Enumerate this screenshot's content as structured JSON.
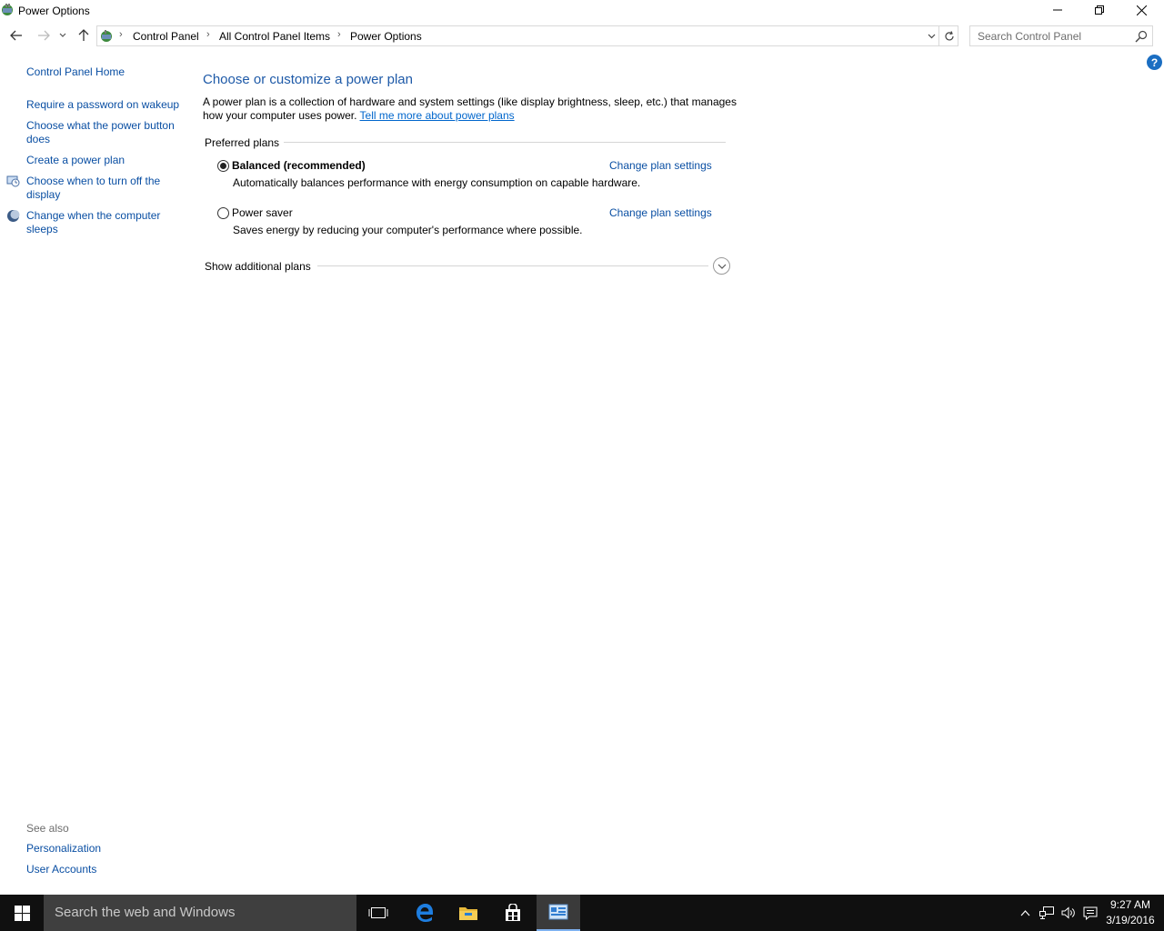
{
  "window": {
    "title": "Power Options"
  },
  "address_bar": {
    "breadcrumbs": [
      "Control Panel",
      "All Control Panel Items",
      "Power Options"
    ]
  },
  "search": {
    "placeholder": "Search Control Panel"
  },
  "help": {
    "label": "?"
  },
  "sidebar": {
    "home": "Control Panel Home",
    "items": [
      {
        "label": "Require a password on wakeup",
        "icon": "none"
      },
      {
        "label": "Choose what the power button does",
        "icon": "none"
      },
      {
        "label": "Create a power plan",
        "icon": "none"
      },
      {
        "label": "Choose when to turn off the display",
        "icon": "display-power-icon"
      },
      {
        "label": "Change when the computer sleeps",
        "icon": "moon-icon"
      }
    ],
    "see_also": {
      "label": "See also",
      "items": [
        "Personalization",
        "User Accounts"
      ]
    }
  },
  "main": {
    "title": "Choose or customize a power plan",
    "description": "A power plan is a collection of hardware and system settings (like display brightness, sleep, etc.) that manages how your computer uses power.",
    "description_link": "Tell me more about power plans",
    "preferred_label": "Preferred plans",
    "plans": [
      {
        "name": "Balanced (recommended)",
        "selected": true,
        "description": "Automatically balances performance with energy consumption on capable hardware.",
        "settings_link": "Change plan settings"
      },
      {
        "name": "Power saver",
        "selected": false,
        "description": "Saves energy by reducing your computer's performance where possible.",
        "settings_link": "Change plan settings"
      }
    ],
    "additional_label": "Show additional plans"
  },
  "taskbar": {
    "search_placeholder": "Search the web and Windows",
    "time": "9:27 AM",
    "date": "3/19/2016"
  },
  "colors": {
    "link": "#0a4fa3",
    "title": "#1e5aa8",
    "taskbar": "#101010"
  }
}
